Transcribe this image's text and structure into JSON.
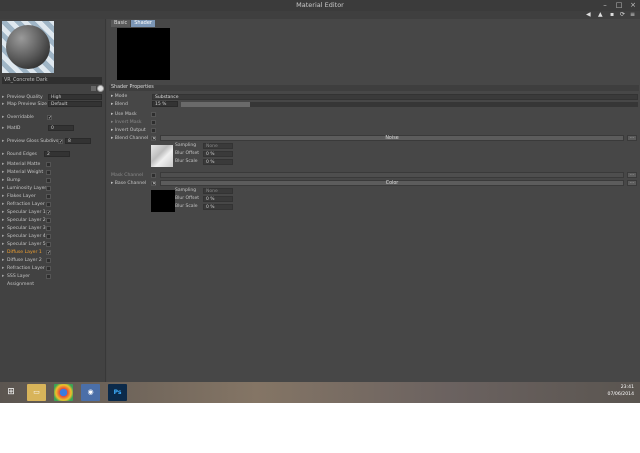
{
  "window": {
    "title": "Material Editor"
  },
  "left_panel": {
    "material_name": "VR_Concrete Dark",
    "preview_quality": {
      "label": "Preview Quality",
      "value": "High"
    },
    "map_preview_size": {
      "label": "Map Preview Size",
      "value": "Default"
    },
    "overridable": {
      "label": "Overridable"
    },
    "matid": {
      "label": "MatID",
      "value": "0"
    },
    "preview_gloss": {
      "label": "Preview Gloss Subdivs",
      "value": "8"
    },
    "round_edges": {
      "label": "Round Edges",
      "value": "2"
    },
    "layers": [
      {
        "label": "Material Matte",
        "checked": false
      },
      {
        "label": "Material Weight",
        "checked": false
      },
      {
        "label": "Bump",
        "checked": false
      },
      {
        "label": "Luminosity Layer",
        "checked": false
      },
      {
        "label": "Flakes Layer",
        "checked": false
      },
      {
        "label": "Refraction Layer",
        "checked": false
      },
      {
        "label": "Specular Layer 1",
        "checked": true
      },
      {
        "label": "Specular Layer 2",
        "checked": false
      },
      {
        "label": "Specular Layer 3",
        "checked": false
      },
      {
        "label": "Specular Layer 4",
        "checked": false
      },
      {
        "label": "Specular Layer 5",
        "checked": false
      },
      {
        "label": "Diffuse Layer 1",
        "checked": true,
        "active": true
      },
      {
        "label": "Diffuse Layer 2",
        "checked": false
      },
      {
        "label": "Refraction Layer",
        "checked": false
      },
      {
        "label": "SSS Layer",
        "checked": false
      },
      {
        "label": "Assignment",
        "checked": null
      }
    ]
  },
  "right_panel": {
    "tabs": [
      {
        "label": "Basic",
        "active": false
      },
      {
        "label": "Shader",
        "active": true
      }
    ],
    "section_title": "Shader Properties",
    "mode": {
      "label": "Mode",
      "value": "Substance"
    },
    "blend": {
      "label": "Blend",
      "value": "15 %",
      "fraction": 0.15
    },
    "use_mask": {
      "label": "Use Mask"
    },
    "invert_mask": {
      "label": "Invert Mask"
    },
    "invert_output": {
      "label": "Invert Output"
    },
    "blend_channel": {
      "label": "Blend Channel",
      "bar": "Noise",
      "sampling": "Sampling",
      "sampling_value": "None",
      "blur_offset": "Blur Offset",
      "blur_offset_value": "0 %",
      "blur_scale": "Blur Scale",
      "blur_scale_value": "0 %"
    },
    "mask_channel": {
      "label": "Mask Channel"
    },
    "base_channel": {
      "label": "Base Channel",
      "bar": "Color",
      "sampling": "Sampling",
      "sampling_value": "None",
      "blur_offset": "Blur Offset",
      "blur_offset_value": "0 %",
      "blur_scale": "Blur Scale",
      "blur_scale_value": "0 %"
    },
    "ellipsis": "..."
  },
  "taskbar": {
    "time": "23:41",
    "date": "07/06/2014",
    "ps_label": "Ps"
  }
}
